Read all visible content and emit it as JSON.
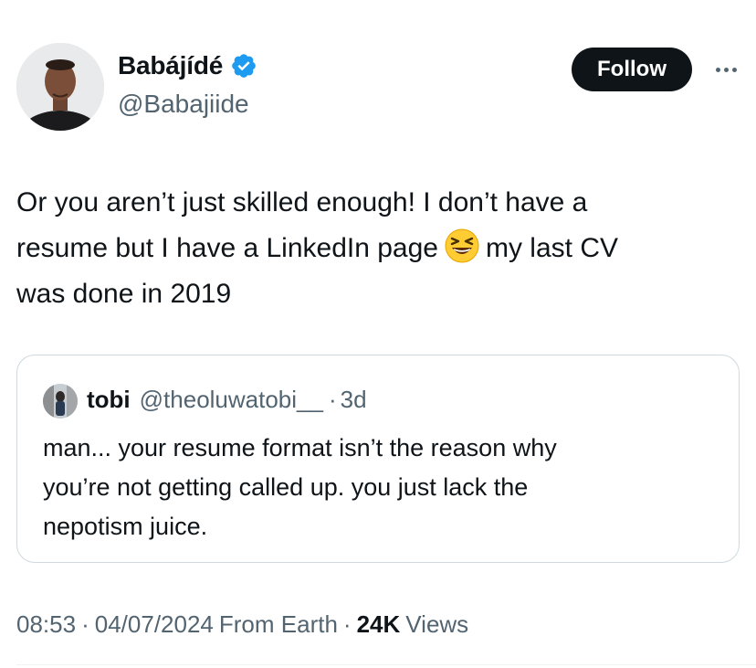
{
  "author": {
    "name": "Babájídé",
    "handle": "@Babajiide",
    "verified": true,
    "verified_color": "#1d9bf0",
    "avatar_icon": "author-avatar-photo"
  },
  "actions": {
    "follow_label": "Follow",
    "more_icon": "more-options-icon"
  },
  "tweet": {
    "line1": "Or you aren’t just skilled enough! I don’t have a",
    "line2_before_emoji": "resume but I have a LinkedIn page",
    "emoji_icon": "grinning-squinting-face-icon",
    "line2_after_emoji": "my last CV",
    "line3": "was done in 2019"
  },
  "quote": {
    "name": "tobi",
    "handle": "@theoluwatobi__",
    "separator": "·",
    "time": "3d",
    "line1": "man... your resume format isn’t the reason why",
    "line2": "you’re not getting called up. you just lack the",
    "line3": "nepotism juice."
  },
  "meta": {
    "time": "08:53",
    "separator1": "·",
    "date": "04/07/2024",
    "source": "From Earth",
    "separator2": "·",
    "views_count": "24K",
    "views_label": "Views"
  },
  "colors": {
    "text_primary": "#0f1419",
    "text_secondary": "#536471",
    "border": "#cfd9de",
    "accent": "#1d9bf0",
    "button_bg": "#0f1419"
  }
}
